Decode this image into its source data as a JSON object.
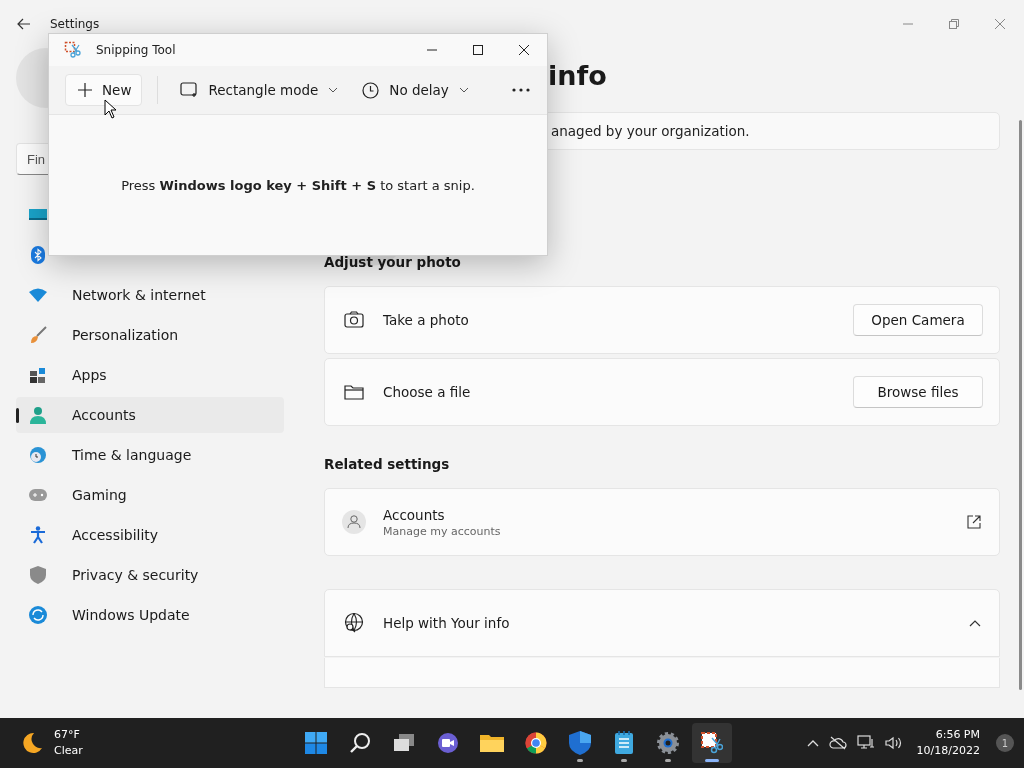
{
  "settings_window": {
    "title": "Settings"
  },
  "sidebar": {
    "search": {
      "placeholder": "Fin"
    },
    "items": [
      {
        "selected": false
      },
      {
        "selected": false
      },
      {
        "label": "Network & internet",
        "selected": false
      },
      {
        "label": "Personalization",
        "selected": false
      },
      {
        "label": "Apps",
        "selected": false
      },
      {
        "label": "Accounts",
        "selected": true
      },
      {
        "label": "Time & language",
        "selected": false
      },
      {
        "label": "Gaming",
        "selected": false
      },
      {
        "label": "Accessibility",
        "selected": false
      },
      {
        "label": "Privacy & security",
        "selected": false
      },
      {
        "label": "Windows Update",
        "selected": false
      }
    ]
  },
  "main": {
    "heading": "info",
    "notice": "anaged by your organization.",
    "sections": [
      {
        "title": "Adjust your photo",
        "cards": [
          {
            "kind": "button",
            "label": "Take a photo",
            "button": "Open Camera"
          },
          {
            "kind": "button",
            "label": "Choose a file",
            "button": "Browse files"
          }
        ]
      },
      {
        "title": "Related settings",
        "cards": [
          {
            "kind": "link",
            "label": "Accounts",
            "sublabel": "Manage my accounts"
          }
        ]
      },
      {
        "cards": [
          {
            "kind": "expander",
            "label": "Help with Your info",
            "expanded": true
          }
        ]
      }
    ]
  },
  "snipping_tool": {
    "title": "Snipping Tool",
    "new_button": "New",
    "mode": "Rectangle mode",
    "delay": "No delay",
    "hint": "Press **Windows logo key + Shift + S** to start a snip."
  },
  "taskbar": {
    "weather": {
      "temperature": "67°F",
      "condition": "Clear"
    },
    "apps": [
      {
        "running": false,
        "active": false
      },
      {
        "running": false,
        "active": false
      },
      {
        "running": false,
        "active": false
      },
      {
        "running": false,
        "active": false
      },
      {
        "running": false,
        "active": false
      },
      {
        "running": false,
        "active": false
      },
      {
        "running": true,
        "active": false
      },
      {
        "running": true,
        "active": false
      },
      {
        "running": true,
        "active": false
      },
      {
        "running": true,
        "active": true
      }
    ],
    "time": "6:56 PM",
    "date": "10/18/2022",
    "notifications": "1"
  }
}
